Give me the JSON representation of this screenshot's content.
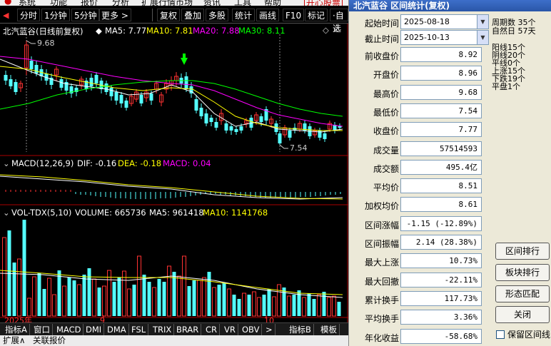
{
  "menu": [
    "系统",
    "功能",
    "报价",
    "分析",
    "扩展行情市场",
    "资讯",
    "工具",
    "帮助"
  ],
  "menu_badge": "开心股票",
  "toolbar": {
    "left": [
      "分时",
      "1分钟",
      "5分钟",
      "更多 >"
    ],
    "right": [
      "复权",
      "叠加",
      "多股",
      "统计",
      "画线",
      "F10",
      "标记",
      "·自选"
    ]
  },
  "kline": {
    "legend_title": "北汽蓝谷(日线前复权)",
    "ma5": "MA5: 7.77",
    "ma10": "MA10: 7.81",
    "ma20": "MA20: 7.88",
    "ma30": "MA30: 8.11",
    "high_mark": "9.68",
    "low_mark": "7.54",
    "colors": {
      "ma5": "#ffffff",
      "ma10": "#ffff00",
      "ma20": "#ff00ff",
      "ma30": "#00ff00",
      "up": "#ff3232",
      "down": "#54ffff"
    }
  },
  "macd": {
    "label": "MACD(12,26,9)",
    "dif": "DIF: -0.16",
    "dea": "DEA: -0.18",
    "macd": "MACD: 0.04"
  },
  "vol": {
    "label": "VOL-TDX(5,10)",
    "volume": "VOLUME: 665736",
    "ma5": "MA5: 961418",
    "ma10": "MA10: 1141768"
  },
  "x_axis": {
    "year": "2025年",
    "m9": "9",
    "m10": "10"
  },
  "bottom_tabs": [
    "指标A",
    "窗口",
    "MACD",
    "DMI",
    "DMA",
    "FSL",
    "TRIX",
    "BRAR",
    "CR",
    "VR",
    "OBV",
    ">",
    "指标B",
    "模板"
  ],
  "bottom_bar": [
    "扩展∧",
    "关联报价"
  ],
  "dialog": {
    "title": "北汽蓝谷 区间统计(复权)",
    "start_label": "起始时间",
    "start_date": "2025-08-18",
    "end_label": "截止时间",
    "end_date": "2025-10-13",
    "rows": [
      {
        "label": "前收盘价",
        "value": "8.92"
      },
      {
        "label": "开盘价",
        "value": "8.96"
      },
      {
        "label": "最高价",
        "value": "9.68"
      },
      {
        "label": "最低价",
        "value": "7.54"
      },
      {
        "label": "收盘价",
        "value": "7.77"
      },
      {
        "label": "成交量",
        "value": "57514593"
      },
      {
        "label": "成交额",
        "value": "495.4亿"
      },
      {
        "label": "平均价",
        "value": "8.51"
      },
      {
        "label": "加权均价",
        "value": "8.61"
      },
      {
        "label": "区间涨幅",
        "value": "-1.15 (-12.89%)"
      },
      {
        "label": "区间振幅",
        "value": "2.14 (28.38%)"
      },
      {
        "label": "最大上涨",
        "value": "10.73%"
      },
      {
        "label": "最大回撤",
        "value": "-22.11%"
      },
      {
        "label": "累计换手",
        "value": "117.73%"
      },
      {
        "label": "平均换手",
        "value": "3.36%"
      },
      {
        "label": "年化收益",
        "value": "-58.68%"
      }
    ],
    "period_stats": [
      {
        "label": "周期数",
        "value": "35个"
      },
      {
        "label": "自然日",
        "value": "57天"
      }
    ],
    "candle_stats": [
      {
        "label": "阳线",
        "value": "15个"
      },
      {
        "label": "阴线",
        "value": "20个"
      },
      {
        "label": "平线",
        "value": "0个"
      },
      {
        "label": "上涨",
        "value": "15个"
      },
      {
        "label": "下跌",
        "value": "19个"
      },
      {
        "label": "平盘",
        "value": "1个"
      }
    ],
    "buttons": [
      "区间排行",
      "板块排行",
      "形态匹配",
      "关闭"
    ],
    "keep_label": "保留区间线"
  }
}
